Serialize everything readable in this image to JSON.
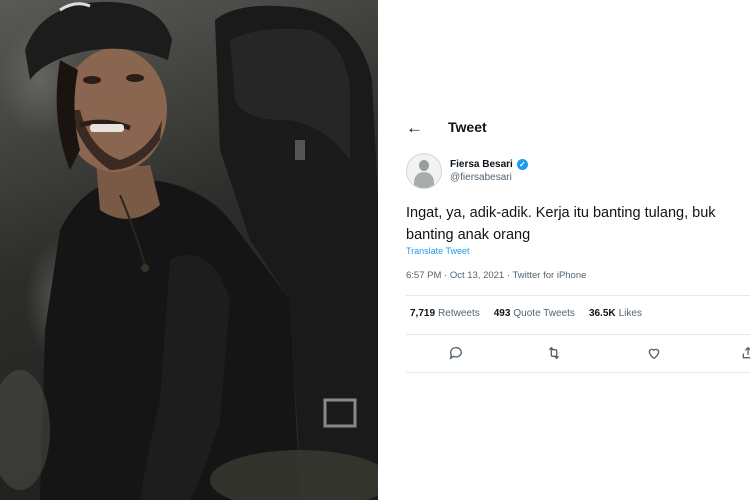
{
  "photo": {
    "alt_subject": "man-with-backpack-photo"
  },
  "tweet": {
    "header_title": "Tweet",
    "author": {
      "name": "Fiersa Besari",
      "handle": "@fiersabesari"
    },
    "text_line1": "Ingat, ya, adik-adik. Kerja itu banting tulang, buk",
    "text_line2": "banting anak orang",
    "translate_label": "Translate Tweet",
    "meta": "6:57 PM · Oct 13, 2021 · Twitter for iPhone",
    "stats": [
      {
        "value": "7,719",
        "label": "Retweets"
      },
      {
        "value": "493",
        "label": "Quote Tweets"
      },
      {
        "value": "36.5K",
        "label": "Likes"
      }
    ],
    "icons": {
      "back": "arrow-left-icon",
      "verified": "verified-badge-icon",
      "reply": "reply-icon",
      "retweet": "retweet-icon",
      "like": "heart-icon",
      "share": "share-icon"
    },
    "colors": {
      "accent": "#1d9bf0",
      "text": "#0f1419",
      "secondary": "#536471"
    }
  }
}
